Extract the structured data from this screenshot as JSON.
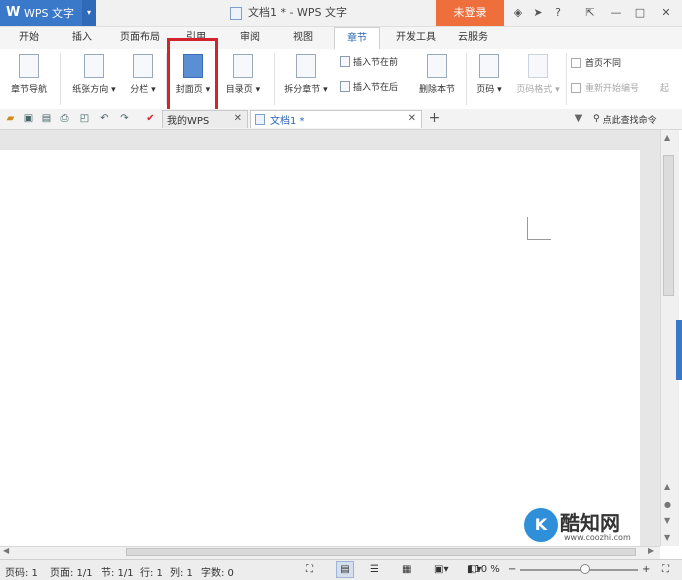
{
  "window": {
    "app_name": "WPS 文字",
    "app_logo": "W",
    "doc_title": "文档1 * - WPS 文字",
    "login_label": "未登录",
    "controls": [
      "?",
      "—",
      "□",
      "✕"
    ]
  },
  "menu": {
    "tabs": [
      "开始",
      "插入",
      "页面布局",
      "引用",
      "审阅",
      "视图",
      "章节",
      "开发工具",
      "云服务"
    ],
    "active": "章节"
  },
  "ribbon": {
    "nav": "章节导航",
    "orientation": "纸张方向",
    "columns": "分栏",
    "cover": "封面页",
    "toc": "目录页",
    "split": "拆分章节",
    "insert_before": "插入节在前",
    "insert_after": "插入节在后",
    "delete_section": "删除本节",
    "page_no": "页码",
    "page_format": "页码格式",
    "first_diff": "首页不同",
    "restart": "重新开始编号",
    "start": "起"
  },
  "quickbar": {
    "tab1": "我的WPS",
    "tab2": "文档1 *",
    "add": "+",
    "search": "点此查找命令"
  },
  "status": {
    "page_code": "页码: 1",
    "pages": "页面: 1/1",
    "section": "节: 1/1",
    "row": "行: 1",
    "col": "列: 1",
    "words": "字数: 0",
    "zoom_label": "110 %",
    "zoom_level": 0.55
  },
  "watermark": {
    "logo_letter": "K",
    "name": "酷知网",
    "url": "www.coozhi.com"
  },
  "colors": {
    "accent": "#3a78c9",
    "login": "#ef6f3c",
    "highlight_box": "#d4242b"
  }
}
